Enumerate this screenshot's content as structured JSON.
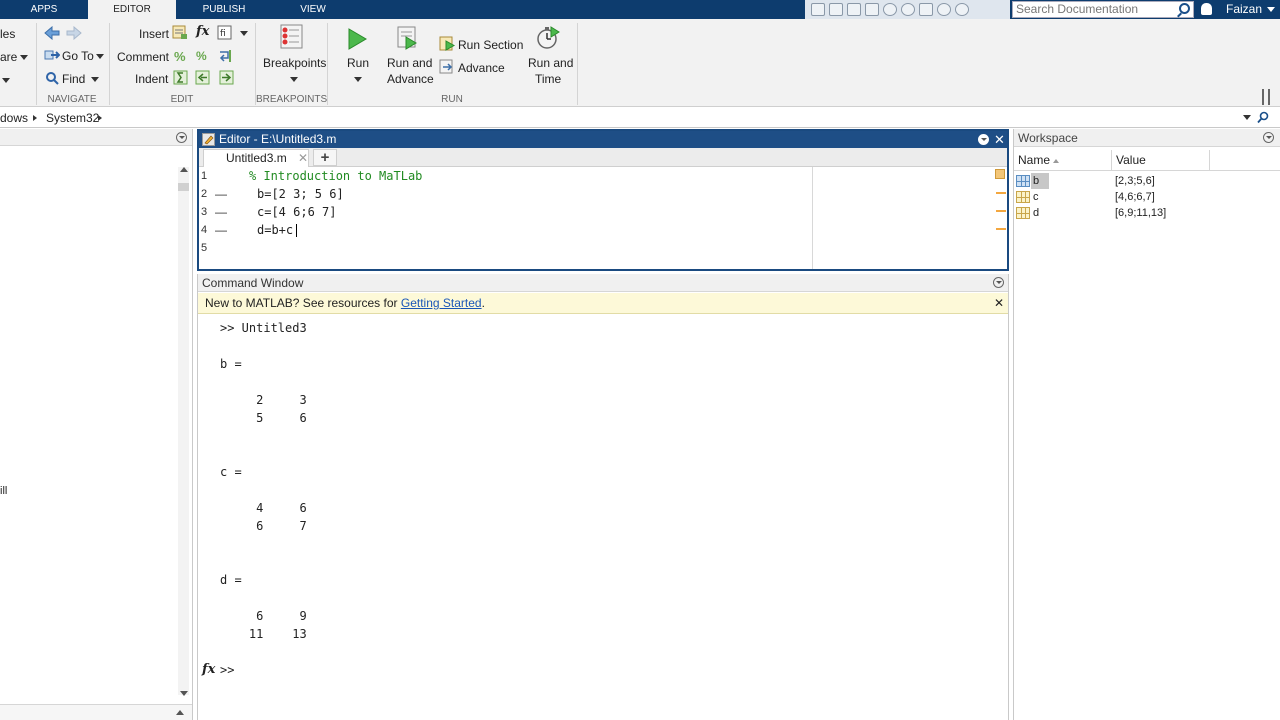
{
  "tabs": {
    "apps": "APPS",
    "editor": "EDITOR",
    "publish": "PUBLISH",
    "view": "VIEW"
  },
  "search": {
    "placeholder": "Search Documentation"
  },
  "user": {
    "name": "Faizan"
  },
  "ribbon": {
    "file_partial_1": "les",
    "file_partial_2": "are",
    "navigate": {
      "goto": "Go To",
      "find": "Find",
      "section": "NAVIGATE"
    },
    "edit": {
      "insert": "Insert",
      "comment": "Comment",
      "indent": "Indent",
      "section": "EDIT"
    },
    "breakpoints": {
      "label": "Breakpoints",
      "section": "BREAKPOINTS"
    },
    "run": {
      "run": "Run",
      "run_and_advance_1": "Run and",
      "run_and_advance_2": "Advance",
      "run_section": "Run Section",
      "advance": "Advance",
      "run_and_time_1": "Run and",
      "run_and_time_2": "Time",
      "section": "RUN"
    }
  },
  "address": {
    "seg1": "dows",
    "seg2": "System32"
  },
  "left_panel": {
    "partial_text": "ill"
  },
  "editor": {
    "title": "Editor - E:\\Untitled3.m",
    "tab": "Untitled3.m",
    "lines": [
      {
        "num": "1",
        "dash": "",
        "text": "% Introduction to MaTLab"
      },
      {
        "num": "2",
        "dash": "—",
        "text": "b=[2 3; 5 6]"
      },
      {
        "num": "3",
        "dash": "—",
        "text": "c=[4 6;6 7]"
      },
      {
        "num": "4",
        "dash": "—",
        "text": "d=b+c"
      },
      {
        "num": "5",
        "dash": "",
        "text": ""
      }
    ]
  },
  "command_window": {
    "title": "Command Window",
    "notice_prefix": "New to MATLAB? See resources for ",
    "notice_link": "Getting Started",
    "notice_suffix": ".",
    "output": ">> Untitled3\n\nb =\n\n     2     3\n     5     6\n\n\nc =\n\n     4     6\n     6     7\n\n\nd =\n\n     6     9\n    11    13\n",
    "fx": "fx",
    "prompt": ">>"
  },
  "workspace": {
    "title": "Workspace",
    "col_name": "Name",
    "col_value": "Value",
    "rows": [
      {
        "name": "b",
        "value": "[2,3;5,6]"
      },
      {
        "name": "c",
        "value": "[4,6;6,7]"
      },
      {
        "name": "d",
        "value": "[6,9;11,13]"
      }
    ]
  }
}
